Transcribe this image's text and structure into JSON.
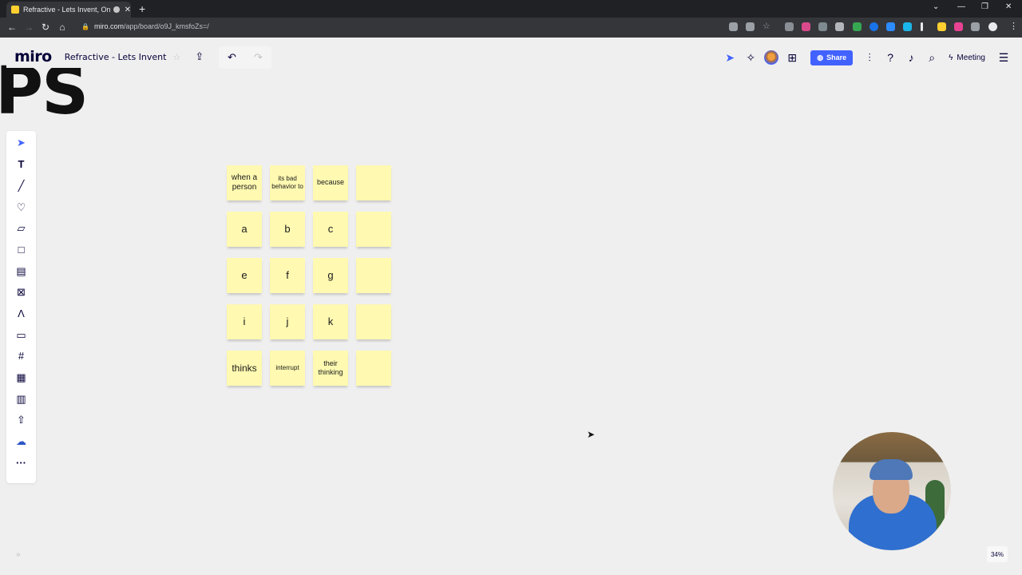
{
  "browser": {
    "tab_title": "Refractive - Lets Invent, Onl",
    "tab_close": "✕",
    "new_tab": "+",
    "url_host": "miro.com",
    "url_path": "/app/board/o9J_kmsfoZs=/"
  },
  "app": {
    "logo": "miro",
    "board_title": "Refractive - Lets Invent",
    "share_label": "Share",
    "meeting_label": "Meeting",
    "zoom_level": "34%"
  },
  "canvas": {
    "background_text": "PS",
    "stickies": [
      {
        "text": "when a person",
        "size": "10px"
      },
      {
        "text": "its bad behavior to",
        "size": "8px"
      },
      {
        "text": "because",
        "size": "9px"
      },
      {
        "text": "",
        "size": "10px"
      },
      {
        "text": "a",
        "size": "13px"
      },
      {
        "text": "b",
        "size": "13px"
      },
      {
        "text": "c",
        "size": "13px"
      },
      {
        "text": "",
        "size": "10px"
      },
      {
        "text": "e",
        "size": "13px"
      },
      {
        "text": "f",
        "size": "13px"
      },
      {
        "text": "g",
        "size": "13px"
      },
      {
        "text": "",
        "size": "10px"
      },
      {
        "text": "i",
        "size": "13px"
      },
      {
        "text": "j",
        "size": "13px"
      },
      {
        "text": "k",
        "size": "13px"
      },
      {
        "text": "",
        "size": "10px"
      },
      {
        "text": "thinks",
        "size": "12px"
      },
      {
        "text": "interrupt",
        "size": "8px"
      },
      {
        "text": "their thinking",
        "size": "9px"
      },
      {
        "text": "",
        "size": "10px"
      }
    ],
    "sticky_color": "#fff9b1"
  },
  "toolbar": {
    "tools": [
      "select-icon",
      "text-icon",
      "pen-icon",
      "heart-icon",
      "sticky-note-icon",
      "shape-icon",
      "card-icon",
      "frame-cross-icon",
      "comment-pen-icon",
      "comment-icon",
      "frame-icon",
      "table-icon",
      "template-icon",
      "upload-icon",
      "brain-icon",
      "more-icon"
    ]
  },
  "colors": {
    "accent": "#4262ff",
    "brand_text": "#050038",
    "canvas": "#efefef"
  }
}
